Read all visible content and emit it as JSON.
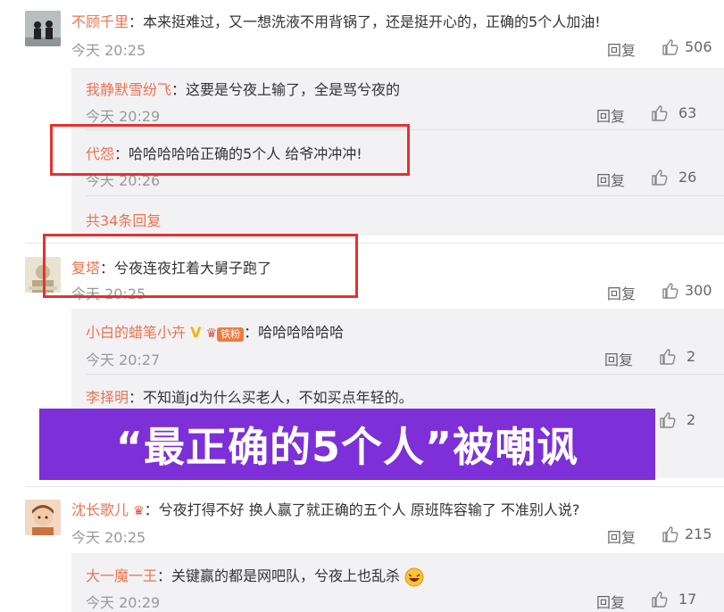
{
  "comments": [
    {
      "user": "不顾千里",
      "text": "：本来挺难过，又一想洗液不用背锅了，还是挺开心的，正确的5个人加油!",
      "time": "今天 20:25",
      "reply_label": "回复",
      "likes": "506",
      "replies": [
        {
          "user": "我静默雪纷飞",
          "text": "：这要是兮夜上输了，全是骂兮夜的",
          "time": "今天 20:29",
          "reply_label": "回复",
          "likes": "63"
        },
        {
          "user": "代怨",
          "text": "：哈哈哈哈哈正确的5个人  给爷冲冲冲!",
          "time": "今天 20:26",
          "reply_label": "回复",
          "likes": "26"
        }
      ],
      "more_label": "共34条回复"
    },
    {
      "user": "复塔",
      "text": "：兮夜连夜扛着大舅子跑了",
      "time": "今天 20:25",
      "reply_label": "回复",
      "likes": "300",
      "replies": [
        {
          "user": "小白的蜡笔小卉",
          "badge_text": "铁粉",
          "text": "：哈哈哈哈哈哈",
          "time": "今天 20:27",
          "reply_label": "回复",
          "likes": "2"
        },
        {
          "user": "李择明",
          "text": "：不知道jd为什么买老人，不如买点年轻的。",
          "time": "",
          "reply_label": "",
          "likes": "2"
        }
      ]
    },
    {
      "user": "沈长歌儿",
      "text": "：兮夜打得不好 换人赢了就正确的五个人  原班阵容输了 不准别人说?",
      "time": "今天 20:25",
      "reply_label": "回复",
      "likes": "215",
      "replies": [
        {
          "user": "大一魔一王",
          "text": "：关键赢的都是网吧队，兮夜上也乱杀",
          "time": "今天 20:29",
          "reply_label": "回复",
          "likes": "17"
        }
      ]
    }
  ],
  "banner_text": "“最正确的5个人”被嘲讽",
  "colors": {
    "accent": "#eb7350",
    "banner": "#7d2fd8",
    "highlight_border": "#e8302d"
  },
  "icons": {
    "like": "thumbs-up-icon",
    "verified": "verified-v-icon",
    "fan_badge": "crown-icon"
  }
}
